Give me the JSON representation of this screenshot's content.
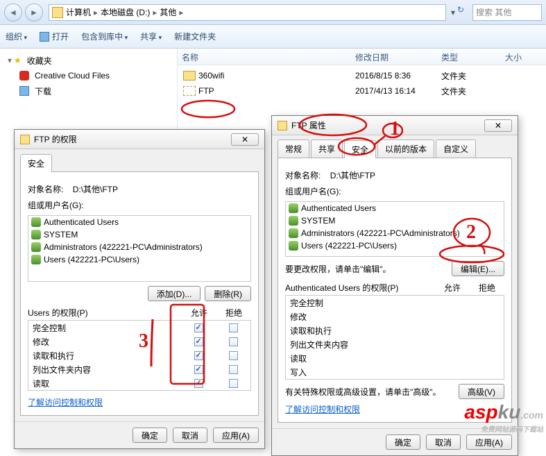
{
  "nav": {
    "crumbs": [
      "计算机",
      "本地磁盘 (D:)",
      "其他"
    ],
    "search_placeholder": "搜索 其他"
  },
  "toolbar": {
    "organize": "组织",
    "open": "打开",
    "include": "包含到库中",
    "share": "共享",
    "newfolder": "新建文件夹"
  },
  "sidebar": {
    "favorites": "收藏夹",
    "items": [
      {
        "label": "Creative Cloud Files"
      },
      {
        "label": "下载"
      }
    ]
  },
  "columns": {
    "name": "名称",
    "modified": "修改日期",
    "type": "类型",
    "size": "大小"
  },
  "files": [
    {
      "name": "360wifi",
      "modified": "2016/8/15 8:36",
      "type": "文件夹"
    },
    {
      "name": "FTP",
      "modified": "2017/4/13 16:14",
      "type": "文件夹"
    }
  ],
  "dlg_perm": {
    "title": "FTP 的权限",
    "tab": "安全",
    "object_label": "对象名称:",
    "object_value": "D:\\其他\\FTP",
    "groups_label": "组或用户名(G):",
    "groups": [
      {
        "t": "Authenticated Users",
        "icon": "users"
      },
      {
        "t": "SYSTEM",
        "icon": "users"
      },
      {
        "t": "Administrators (422221-PC\\Administrators)",
        "icon": "users"
      },
      {
        "t": "Users (422221-PC\\Users)",
        "icon": "users"
      }
    ],
    "add": "添加(D)...",
    "remove": "删除(R)",
    "perm_for": "Users 的权限(P)",
    "allow": "允许",
    "deny": "拒绝",
    "perms": [
      {
        "n": "完全控制",
        "a": true,
        "d": false
      },
      {
        "n": "修改",
        "a": true,
        "d": false
      },
      {
        "n": "读取和执行",
        "a": true,
        "d": false
      },
      {
        "n": "列出文件夹内容",
        "a": true,
        "d": false
      },
      {
        "n": "读取",
        "a": true,
        "d": false
      }
    ],
    "link": "了解访问控制和权限",
    "ok": "确定",
    "cancel": "取消",
    "apply": "应用(A)"
  },
  "dlg_prop": {
    "title": "FTP 属性",
    "tabs": [
      "常规",
      "共享",
      "安全",
      "以前的版本",
      "自定义"
    ],
    "active_tab": 2,
    "object_label": "对象名称:",
    "object_value": "D:\\其他\\FTP",
    "groups_label": "组或用户名(G):",
    "groups": [
      {
        "t": "Authenticated Users",
        "icon": "users"
      },
      {
        "t": "SYSTEM",
        "icon": "users"
      },
      {
        "t": "Administrators (422221-PC\\Administrators)",
        "icon": "users"
      },
      {
        "t": "Users (422221-PC\\Users)",
        "icon": "users"
      }
    ],
    "edit_hint": "要更改权限，请单击\"编辑\"。",
    "edit": "编辑(E)...",
    "perm_for": "Authenticated Users 的权限(P)",
    "allow": "允许",
    "deny": "拒绝",
    "perms": [
      {
        "n": "完全控制"
      },
      {
        "n": "修改"
      },
      {
        "n": "读取和执行"
      },
      {
        "n": "列出文件夹内容"
      },
      {
        "n": "读取"
      },
      {
        "n": "写入"
      }
    ],
    "adv_hint": "有关特殊权限或高级设置，请单击\"高级\"。",
    "advanced": "高级(V)",
    "link": "了解访问控制和权限",
    "ok": "确定",
    "cancel": "取消",
    "apply": "应用(A)"
  },
  "watermark": {
    "a": "asp",
    "b": "ku",
    "c": ".com",
    "d": "免费网站源码下载站"
  }
}
